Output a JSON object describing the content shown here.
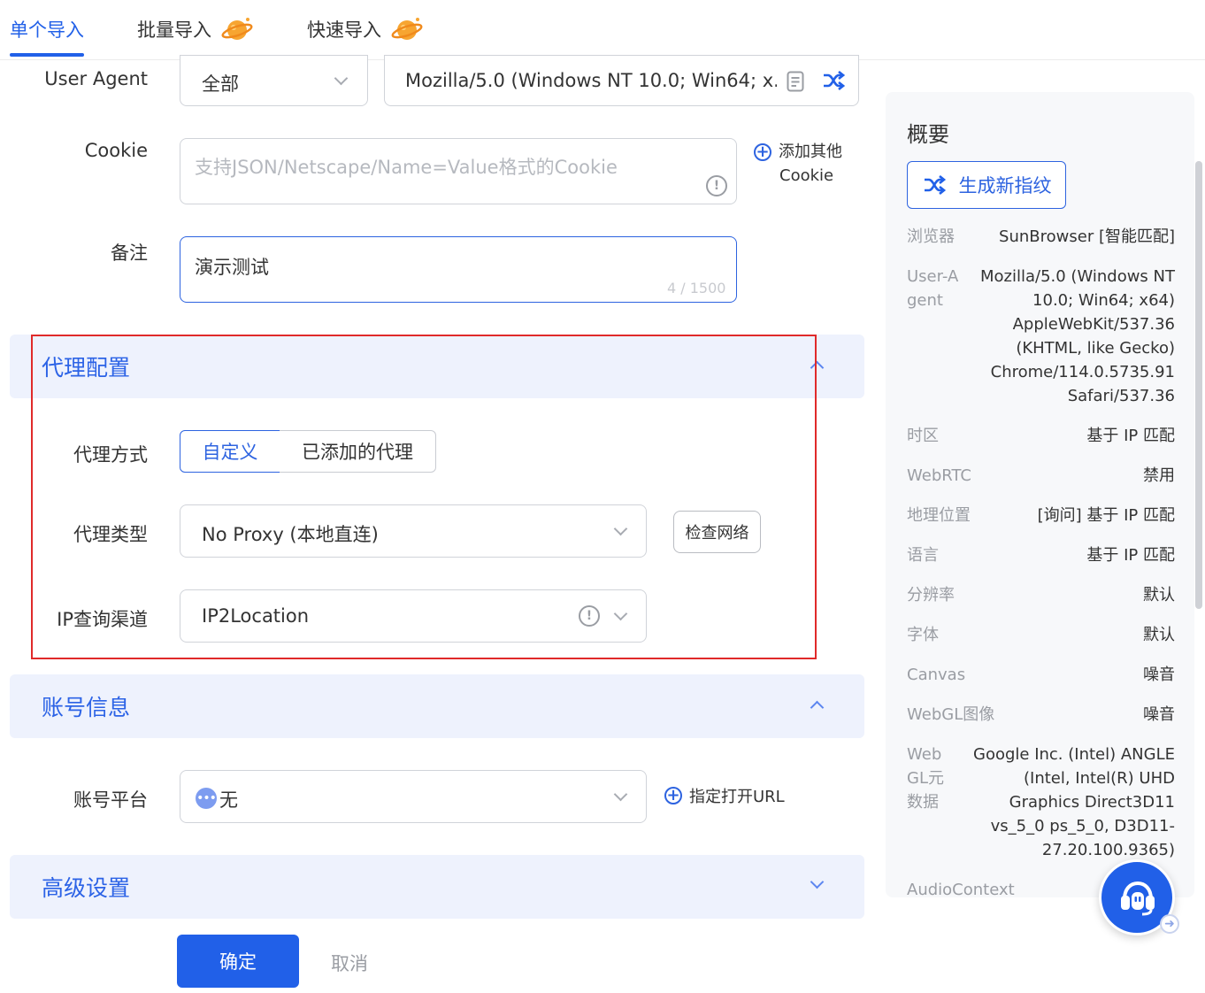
{
  "tabs": [
    {
      "label": "单个导入",
      "active": true
    },
    {
      "label": "批量导入",
      "active": false
    },
    {
      "label": "快速导入",
      "active": false
    }
  ],
  "user_agent": {
    "label": "User Agent",
    "filter_value": "全部",
    "value": "Mozilla/5.0 (Windows NT 10.0; Win64; x..."
  },
  "cookie": {
    "label": "Cookie",
    "placeholder": "支持JSON/Netscape/Name=Value格式的Cookie",
    "add_other": "添加其他",
    "add_other_2": "Cookie"
  },
  "remark": {
    "label": "备注",
    "value": "演示测试",
    "counter": "4 / 1500"
  },
  "proxy_section": {
    "title": "代理配置",
    "method_label": "代理方式",
    "method_options": [
      "自定义",
      "已添加的代理"
    ],
    "type_label": "代理类型",
    "type_value": "No Proxy (本地直连)",
    "check_network": "检查网络",
    "ip_channel_label": "IP查询渠道",
    "ip_channel_value": "IP2Location"
  },
  "account_section": {
    "title": "账号信息",
    "platform_label": "账号平台",
    "platform_value": "无",
    "open_url": "指定打开URL"
  },
  "advanced_section": {
    "title": "高级设置"
  },
  "summary": {
    "title": "概要",
    "generate_button": "生成新指纹",
    "rows": [
      {
        "key": "浏览器",
        "value": "SunBrowser [智能匹配]"
      },
      {
        "key": "User-Agent",
        "value": "Mozilla/5.0 (Windows NT 10.0; Win64; x64) AppleWebKit/537.36 (KHTML, like Gecko) Chrome/114.0.5735.91 Safari/537.36"
      },
      {
        "key": "时区",
        "value": "基于 IP 匹配"
      },
      {
        "key": "WebRTC",
        "value": "禁用"
      },
      {
        "key": "地理位置",
        "value": "[询问] 基于 IP 匹配"
      },
      {
        "key": "语言",
        "value": "基于 IP 匹配"
      },
      {
        "key": "分辨率",
        "value": "默认"
      },
      {
        "key": "字体",
        "value": "默认"
      },
      {
        "key": "Canvas",
        "value": "噪音"
      },
      {
        "key": "WebGL图像",
        "value": "噪音"
      },
      {
        "key": "WebGL元数据",
        "value": "Google Inc. (Intel) ANGLE (Intel, Intel(R) UHD Graphics Direct3D11 vs_5_0 ps_5_0, D3D11-27.20.100.9365)"
      },
      {
        "key": "AudioContext",
        "value": ""
      }
    ]
  },
  "footer": {
    "confirm": "确定",
    "cancel": "取消"
  },
  "colors": {
    "accent": "#2160e8",
    "section_bg": "#eef2fd",
    "highlight_border": "#e02a2a"
  },
  "icons": {
    "planet": "planet-icon",
    "shuffle": "shuffle-icon",
    "document": "document-icon",
    "info": "info-icon",
    "chevron": "chevron-down-icon",
    "plus": "plus-circle-icon",
    "support": "headset-icon"
  }
}
